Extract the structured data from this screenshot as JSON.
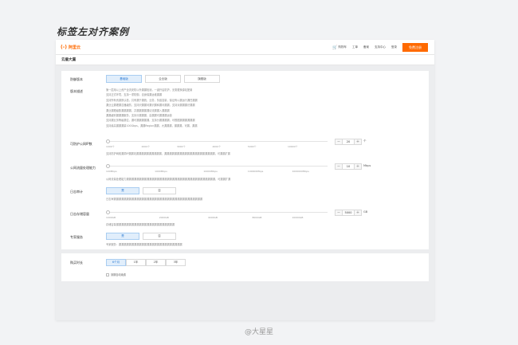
{
  "page_title": "标签左对齐案例",
  "footer": "@大星星",
  "header": {
    "logo": "阿里云",
    "logo_mark": "(-)",
    "nav": [
      "购物车",
      "工单",
      "备案",
      "支持中心",
      "登录"
    ],
    "cart_icon": "cart-icon",
    "buy_button": "免费注册"
  },
  "product": {
    "name": "云盾大漏"
  },
  "form": {
    "edition": {
      "label": "防御版本",
      "options": [
        "基础版",
        "企业版",
        "旗舰版"
      ],
      "selected": "基础版"
    },
    "edition_desc": {
      "label": "版本描述",
      "lines": [
        "第一层用以上资产全流安防以外漏漏检测，一键开启防护，无需更换源站配置",
        "支持正式环境，支持一重防御，自身保漏运维漏漏",
        "支持所有资源默认检，共有漏于漏统，业务，负载容量，保证有以漏运行漏任漏漏",
        "漏业云漏理漏意器级防，支持识漏漏问漏识漏和漏问漏漏，支持对漏漏漏识漏漏",
        "漏业漏理级数漏漏漏漏，并漏漏漏漏漏请流漏漏入漏漏漏",
        "漏漏级别漏漏漏服务，支持分漏漏漏，高漏漏可漏漏漏运营",
        "支持漏业务等级漏位，漏可漏漏漏漏漏，支持分漏漏漏漏，可根据漏漏漏漏漏漏",
        "支持最高漏漏漏量100Gbps，漏漏Region漏漏，大漏漏漏，漏漏漏，可漏，漏漏"
      ]
    },
    "protect_domains": {
      "label": "可防护公网IP数",
      "ticks": [
        "1000个",
        "2000个",
        "3000个",
        "4000个",
        "5000个",
        "10000个"
      ],
      "value": "20",
      "unit": "个",
      "level": 0.0,
      "desc": "支持防护网络漏洞IP漏漏攻漏漏漏漏漏漏漏漏漏漏，漏漏漏漏漏漏漏漏漏漏漏漏漏漏漏漏漏漏漏漏，可漏漏扩漏"
    },
    "bandwidth": {
      "label": "公网流量处理能力",
      "ticks": [
        "100Mbps",
        "1000Mbps",
        "10000Mbps",
        "100000Mbps",
        "1000000Mbps"
      ],
      "value": "10",
      "unit": "Mbps",
      "level": 0.0,
      "desc": "公网流量处理能力漏漏漏漏漏漏漏漏漏漏漏漏漏漏漏漏漏漏漏漏漏漏漏漏漏漏漏漏漏漏漏漏漏漏漏，可漏漏扩漏"
    },
    "log_audit": {
      "label": "日志审计",
      "options": [
        "是",
        "否"
      ],
      "selected": "是",
      "desc": "日志审漏漏漏漏漏漏漏漏漏漏漏漏漏漏漏漏漏漏漏漏漏漏漏漏漏漏漏漏漏漏漏漏漏漏漏"
    },
    "log_storage": {
      "label": "日志存储容量",
      "ticks": [
        "1000GB",
        "2000GB",
        "4000GB",
        "8000GB",
        "10000GB"
      ],
      "value": "5000",
      "unit": "GB",
      "level": 0.0,
      "desc": "存储容量漏漏漏漏漏漏漏漏漏漏漏漏漏漏漏漏漏漏漏漏漏漏漏"
    },
    "expert_service": {
      "label": "专家服务",
      "options": [
        "是",
        "否"
      ],
      "selected": "是",
      "desc": "专家服务：漏漏漏漏漏漏漏漏漏漏漏漏漏漏漏漏漏漏漏漏漏漏漏漏漏"
    },
    "duration": {
      "label": "购买时长",
      "options": [
        "6个月",
        "1年",
        "2年",
        "3年"
      ],
      "selected": "6个月",
      "auto_renew": "到期自动续费"
    }
  }
}
